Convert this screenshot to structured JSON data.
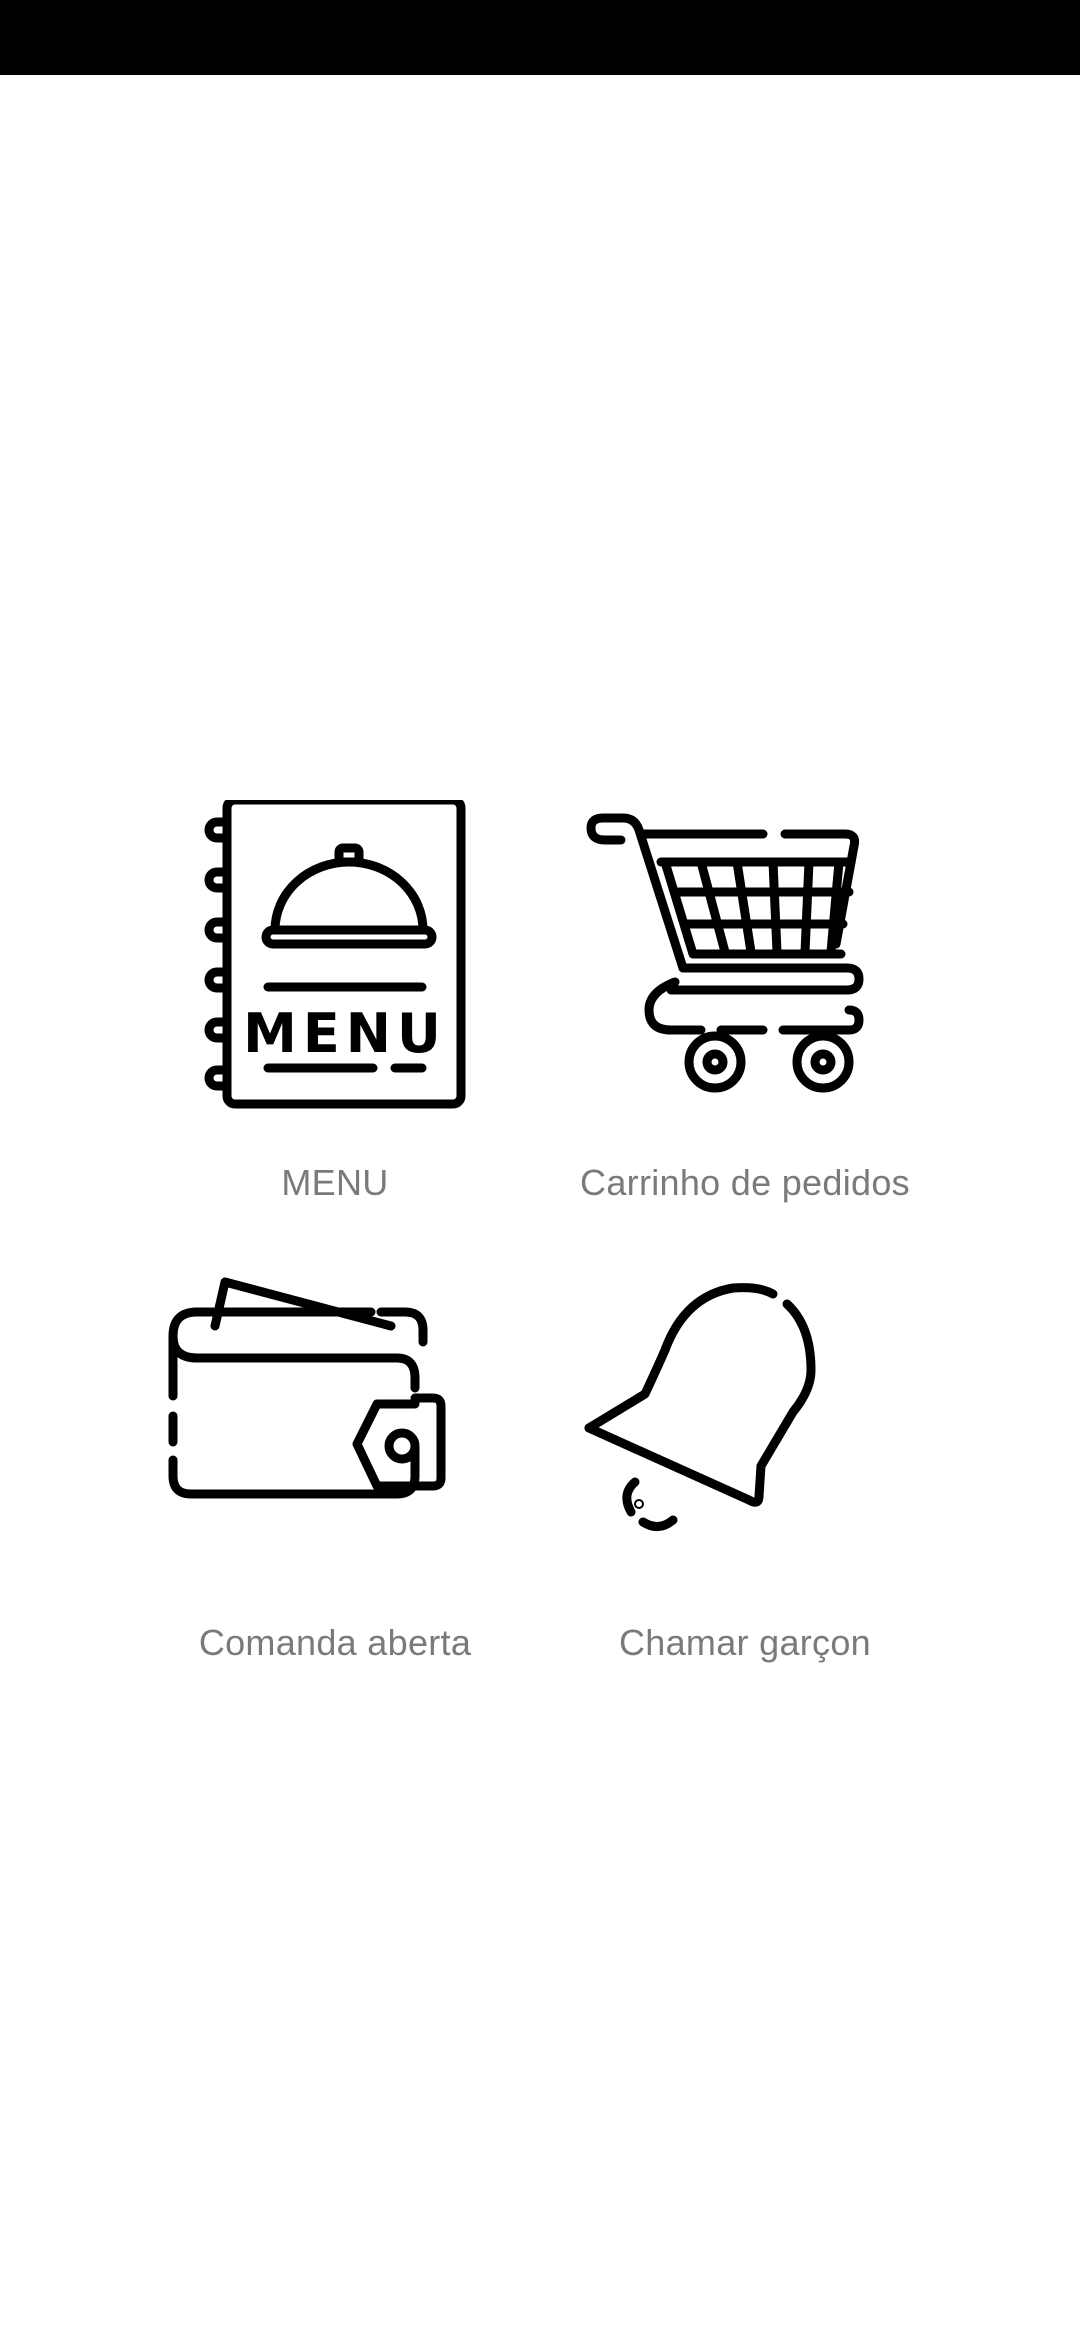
{
  "status_bar": {
    "color": "#000000"
  },
  "grid": {
    "items": [
      {
        "id": "menu",
        "label": "MENU",
        "icon": "menu-book-icon",
        "icon_text": "MENU"
      },
      {
        "id": "cart",
        "label": "Carrinho de pedidos",
        "icon": "shopping-cart-icon"
      },
      {
        "id": "wallet",
        "label": "Comanda aberta",
        "icon": "wallet-icon"
      },
      {
        "id": "bell",
        "label": "Chamar garçon",
        "icon": "bell-icon"
      }
    ]
  },
  "colors": {
    "label": "#7a7a7a",
    "icon": "#000000",
    "background": "#ffffff"
  }
}
